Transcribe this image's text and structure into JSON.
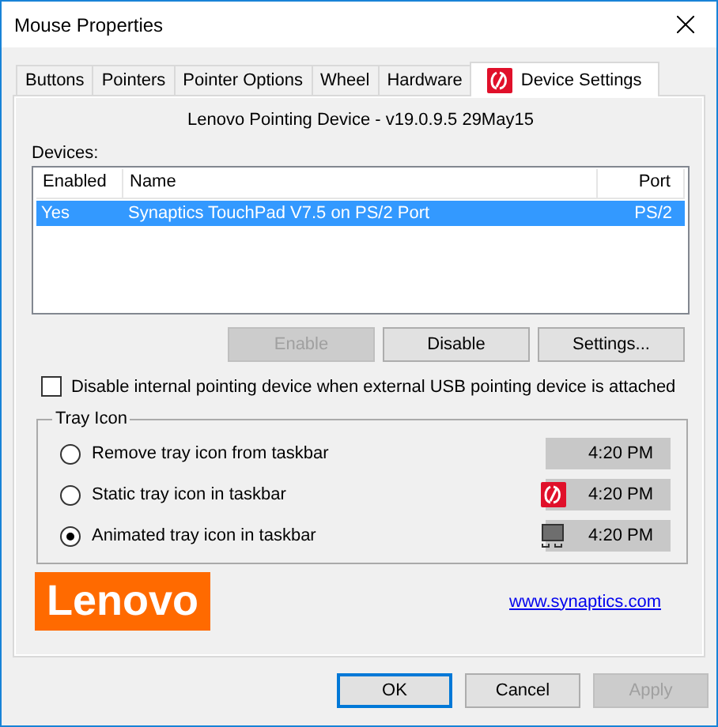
{
  "window": {
    "title": "Mouse Properties"
  },
  "tabs": [
    {
      "label": "Buttons",
      "selected": false
    },
    {
      "label": "Pointers",
      "selected": false
    },
    {
      "label": "Pointer Options",
      "selected": false
    },
    {
      "label": "Wheel",
      "selected": false
    },
    {
      "label": "Hardware",
      "selected": false
    },
    {
      "label": "Device Settings",
      "selected": true,
      "has_icon": true
    }
  ],
  "heading": "Lenovo Pointing Device - v19.0.9.5 29May15",
  "devices": {
    "label": "Devices:",
    "columns": [
      "Enabled",
      "Name",
      "Port"
    ],
    "rows": [
      {
        "cells": [
          "Yes",
          "Synaptics TouchPad V7.5 on PS/2 Port",
          "PS/2"
        ],
        "selected": true
      }
    ]
  },
  "device_buttons": [
    {
      "label": "Enable",
      "disabled": true
    },
    {
      "label": "Disable",
      "disabled": false
    },
    {
      "label": "Settings...",
      "disabled": false
    }
  ],
  "disable_internal": {
    "label": "Disable internal pointing device when external USB pointing device is attached",
    "checked": false
  },
  "tray": {
    "title": "Tray Icon",
    "options": [
      {
        "label": "Remove tray icon from taskbar",
        "selected": false,
        "kind": "none",
        "time": "4:20 PM"
      },
      {
        "label": "Static tray icon in taskbar",
        "selected": false,
        "kind": "static",
        "time": "4:20 PM"
      },
      {
        "label": "Animated tray icon in taskbar",
        "selected": true,
        "kind": "animated",
        "time": "4:20 PM"
      }
    ]
  },
  "logo": "Lenovo",
  "link": "www.synaptics.com",
  "buttons": [
    {
      "label": "OK",
      "disabled": false,
      "default": true
    },
    {
      "label": "Cancel",
      "disabled": false,
      "default": false
    },
    {
      "label": "Apply",
      "disabled": true,
      "default": false
    }
  ]
}
